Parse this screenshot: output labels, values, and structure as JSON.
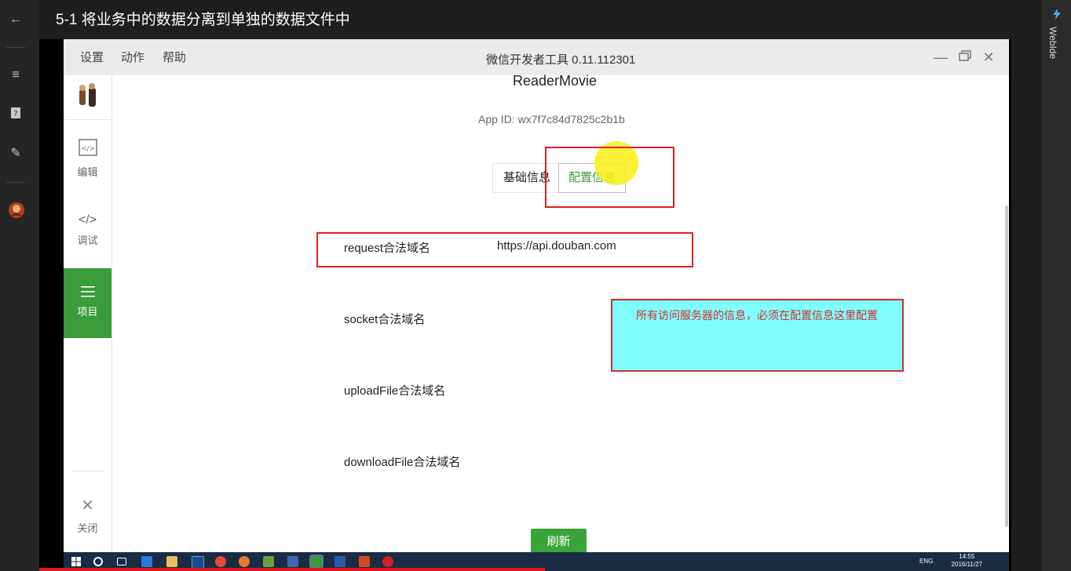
{
  "video": {
    "title": "5-1 将业务中的数据分离到单独的数据文件中",
    "right_rail_label": "WebIde"
  },
  "app": {
    "menu": [
      "设置",
      "动作",
      "帮助"
    ],
    "title": "微信开发者工具 0.11.112301",
    "window_controls": [
      "minimize-icon",
      "restore-icon",
      "close-icon"
    ]
  },
  "sidebar": {
    "items": [
      {
        "label": "编辑",
        "icon": "code-file-icon"
      },
      {
        "label": "调试",
        "icon": "code-brackets-icon"
      },
      {
        "label": "项目",
        "icon": "menu-lines-icon",
        "active": true
      },
      {
        "label": "关闭",
        "icon": "close-x-icon"
      }
    ]
  },
  "project": {
    "name": "ReaderMovie",
    "app_id": "App ID: wx7f7c84d7825c2b1b",
    "tabs": [
      "基础信息",
      "配置信息"
    ],
    "active_tab": "配置信息",
    "fields": [
      {
        "label": "request合法域名",
        "value": "https://api.douban.com"
      },
      {
        "label": "socket合法域名",
        "value": ""
      },
      {
        "label": "uploadFile合法域名",
        "value": ""
      },
      {
        "label": "downloadFile合法域名",
        "value": ""
      }
    ],
    "refresh_label": "刷新"
  },
  "annotation": {
    "note": "所有访问服务器的信息，必须在配置信息这里配置"
  },
  "taskbar": {
    "time": "14:55",
    "date": "2016/11/27",
    "lang": "ENG"
  },
  "colors": {
    "accent_green": "#3a9c3a",
    "annotation_red": "#e02020",
    "note_bg": "#80fcfc",
    "highlight_yellow": "#faf014"
  },
  "playback": {
    "progress_fraction": 0.52
  }
}
